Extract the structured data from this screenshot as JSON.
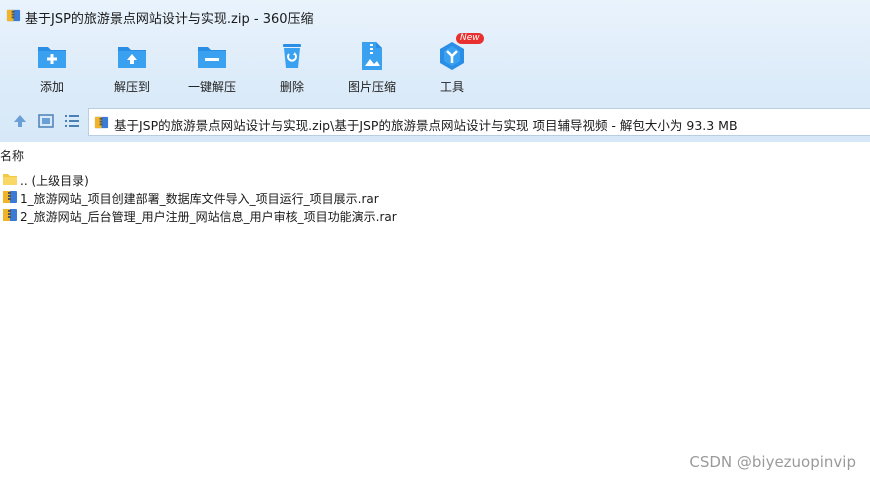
{
  "window": {
    "title": "基于JSP的旅游景点网站设计与实现.zip - 360压缩"
  },
  "toolbar": {
    "items": [
      {
        "label": "添加",
        "icon": "add-folder-icon"
      },
      {
        "label": "解压到",
        "icon": "extract-to-icon"
      },
      {
        "label": "一键解压",
        "icon": "one-click-extract-icon"
      },
      {
        "label": "删除",
        "icon": "trash-icon"
      },
      {
        "label": "图片压缩",
        "icon": "image-compress-icon"
      },
      {
        "label": "工具",
        "icon": "tools-icon",
        "badge": "New"
      }
    ]
  },
  "navbar": {
    "up_icon": "up-arrow-icon",
    "thumb_view_icon": "thumbnail-view-icon",
    "list_view_icon": "list-view-icon",
    "address": "基于JSP的旅游景点网站设计与实现.zip\\基于JSP的旅游景点网站设计与实现 项目辅导视频 - 解包大小为 93.3 MB"
  },
  "filelist": {
    "column_name": "名称",
    "rows": [
      {
        "name": ".. (上级目录)",
        "icon": "folder-icon"
      },
      {
        "name": "1_旅游网站_项目创建部署_数据库文件导入_项目运行_项目展示.rar",
        "icon": "rar-archive-icon"
      },
      {
        "name": "2_旅游网站_后台管理_用户注册_网站信息_用户审核_项目功能演示.rar",
        "icon": "rar-archive-icon"
      }
    ]
  },
  "watermark": "CSDN @biyezuopinvip",
  "colors": {
    "accent_blue": "#1e8be0",
    "chrome_bg": "#dcebf9",
    "badge_red": "#e8312e"
  }
}
